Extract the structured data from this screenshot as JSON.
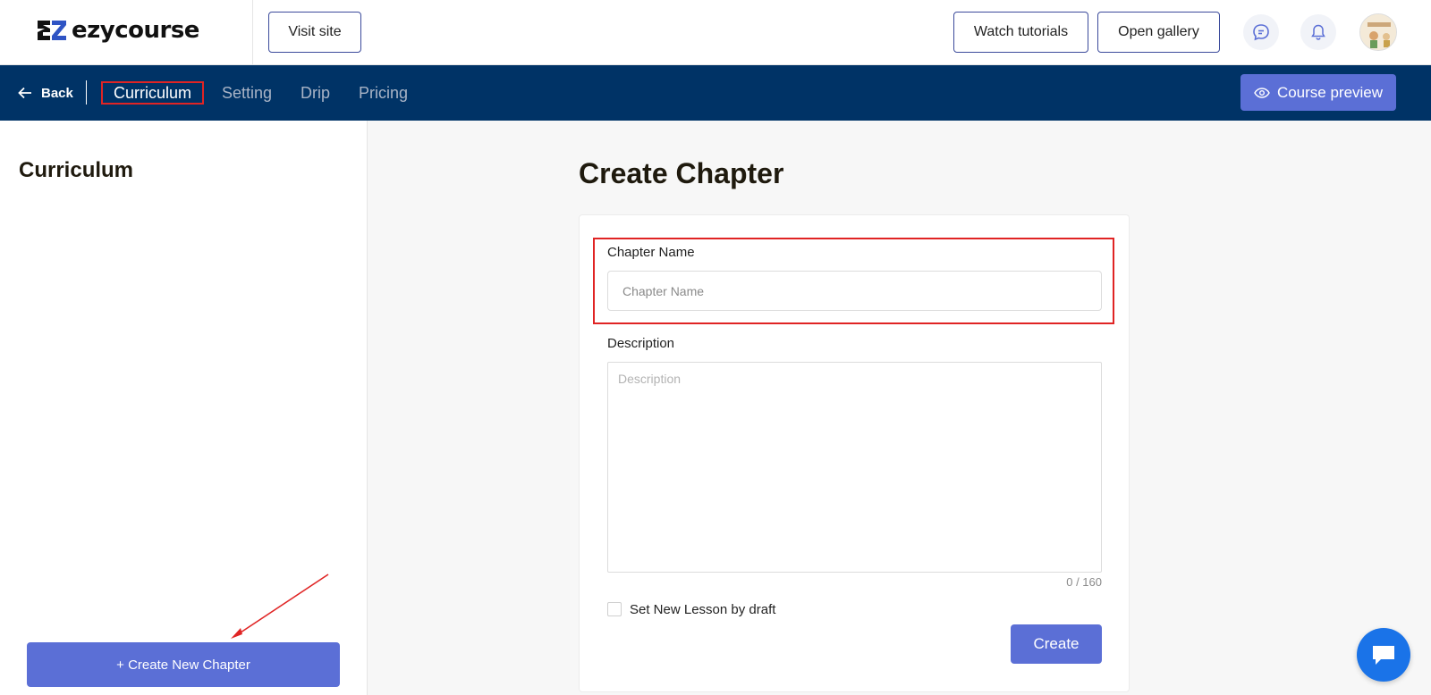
{
  "header": {
    "logo_text": "ezycourse",
    "visit_site_label": "Visit site",
    "watch_tutorials_label": "Watch tutorials",
    "open_gallery_label": "Open gallery",
    "icons": [
      "chat-bubble-icon",
      "bell-icon",
      "avatar"
    ]
  },
  "nav": {
    "back_label": "Back",
    "tabs": [
      {
        "label": "Curriculum",
        "active": true
      },
      {
        "label": "Setting",
        "active": false
      },
      {
        "label": "Drip",
        "active": false
      },
      {
        "label": "Pricing",
        "active": false
      }
    ],
    "preview_label": "Course preview"
  },
  "sidebar": {
    "title": "Curriculum",
    "create_button_label": "+ Create New Chapter"
  },
  "main": {
    "title": "Create Chapter",
    "chapter_name_label": "Chapter Name",
    "chapter_name_placeholder": "Chapter Name",
    "chapter_name_value": "",
    "description_label": "Description",
    "description_placeholder": "Description",
    "description_value": "",
    "counter": "0 / 160",
    "draft_checkbox_label": "Set New Lesson by draft",
    "draft_checked": false,
    "create_label": "Create"
  },
  "colors": {
    "navy": "#003366",
    "accent": "#5b6fd6",
    "annotation_red": "#e02424",
    "chat_blue": "#1a73e8"
  }
}
